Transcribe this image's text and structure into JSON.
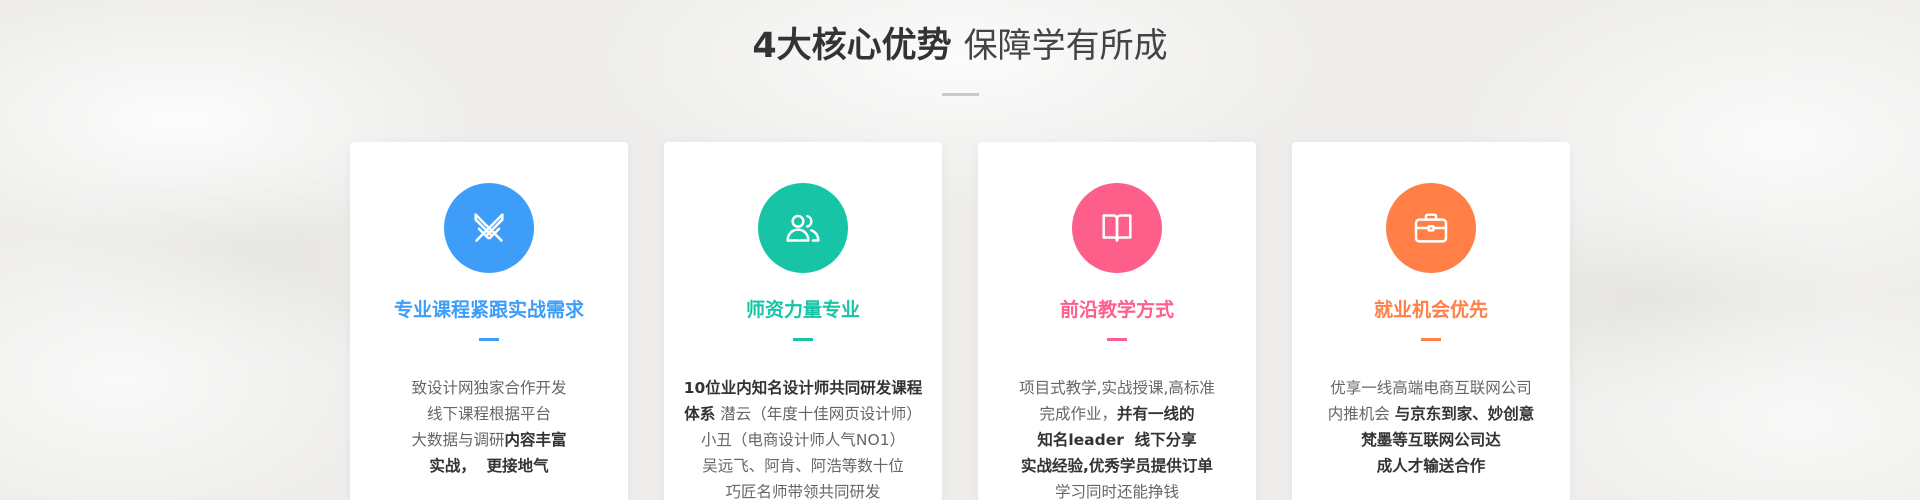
{
  "section": {
    "title_bold": "4大核心优势",
    "title_normal": "保障学有所成"
  },
  "colors": {
    "title_bold": "#333333",
    "title_normal": "#444444",
    "divider": "#c9c9c9",
    "body_text": "#666666",
    "body_bold": "#333333",
    "card_background": "#ffffff"
  },
  "cards": [
    {
      "title": "专业课程紧跟实战需求",
      "color": "#3d9df9",
      "icon": "crossed-swords-icon",
      "lines": [
        [
          {
            "text": "致设计网独家合作开发",
            "bold": false
          }
        ],
        [
          {
            "text": "线下课程根据平台",
            "bold": false
          }
        ],
        [
          {
            "text": "大数据与调研",
            "bold": false
          },
          {
            "text": "内容丰富",
            "bold": true
          }
        ],
        [
          {
            "text": "实战，  更接地气",
            "bold": true
          }
        ]
      ]
    },
    {
      "title": "师资力量专业",
      "color": "#17c5a6",
      "icon": "users-icon",
      "lines": [
        [
          {
            "text": "10位业内知名设计师共同研发课程",
            "bold": true
          }
        ],
        [
          {
            "text": "体系",
            "bold": true
          },
          {
            "text": " 潜云（年度十佳网页设计师）",
            "bold": false
          }
        ],
        [
          {
            "text": "小丑（电商设计师人气NO1）",
            "bold": false
          }
        ],
        [
          {
            "text": "吴远飞、阿肯、阿浩等数十位",
            "bold": false
          }
        ],
        [
          {
            "text": "巧匠名师带领共同研发",
            "bold": false
          }
        ]
      ]
    },
    {
      "title": "前沿教学方式",
      "color": "#fd5f8a",
      "icon": "book-icon",
      "lines": [
        [
          {
            "text": "项目式教学,实战授课,高标准",
            "bold": false
          }
        ],
        [
          {
            "text": "完成作业，",
            "bold": false
          },
          {
            "text": "并有一线的",
            "bold": true
          }
        ],
        [
          {
            "text": "知名leader  线下分享",
            "bold": true
          }
        ],
        [
          {
            "text": "实战经验,优秀学员提供订单",
            "bold": true
          }
        ],
        [
          {
            "text": "学习同时还能挣钱",
            "bold": false
          }
        ]
      ]
    },
    {
      "title": "就业机会优先",
      "color": "#ff7f46",
      "icon": "briefcase-icon",
      "lines": [
        [
          {
            "text": "优享一线高端电商互联网公司",
            "bold": false
          }
        ],
        [
          {
            "text": "内推机会 ",
            "bold": false
          },
          {
            "text": "与京东到家、妙创意",
            "bold": true
          }
        ],
        [
          {
            "text": "梵墨等互联网公司达",
            "bold": true
          }
        ],
        [
          {
            "text": "成人才输送合作",
            "bold": true
          }
        ]
      ]
    }
  ]
}
